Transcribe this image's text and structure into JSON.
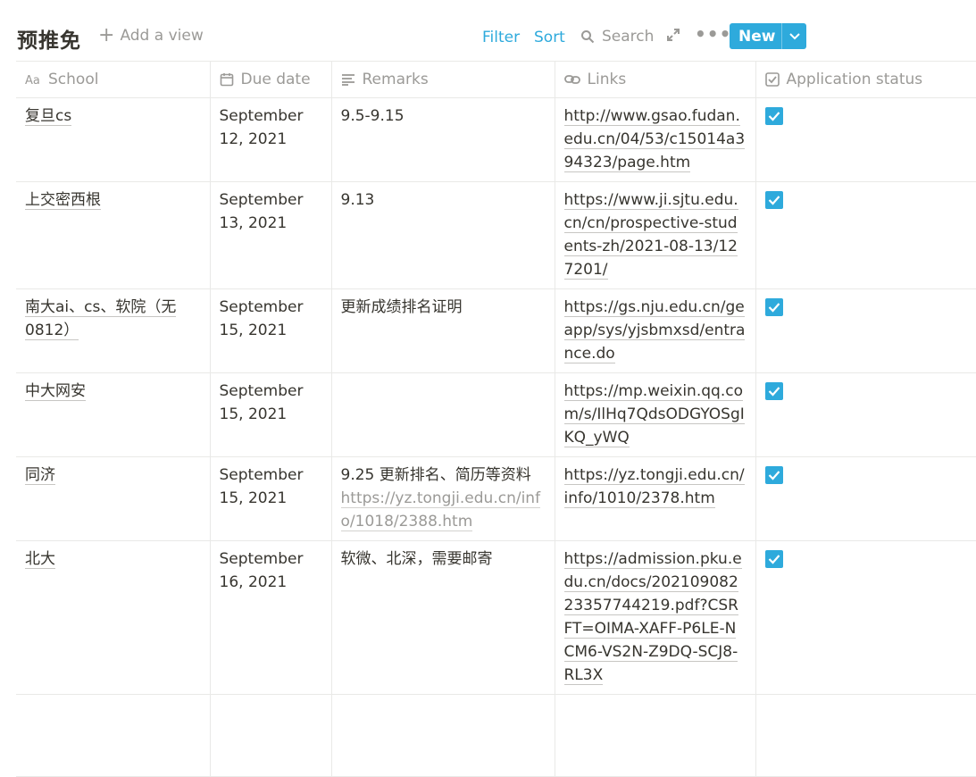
{
  "page": {
    "title": "预推免",
    "add_view": "Add a view"
  },
  "toolbar": {
    "filter": "Filter",
    "sort": "Sort",
    "search": "Search",
    "new": "New"
  },
  "columns": [
    {
      "label": "School",
      "icon": "text-aa-icon"
    },
    {
      "label": "Due date",
      "icon": "calendar-icon"
    },
    {
      "label": "Remarks",
      "icon": "text-lines-icon"
    },
    {
      "label": "Links",
      "icon": "link-icon"
    },
    {
      "label": "Application status",
      "icon": "checkbox-icon"
    }
  ],
  "rows": [
    {
      "school": "复旦cs",
      "due": "September 12, 2021",
      "remark": "9.5-9.15",
      "remark_link": "",
      "link": "http://www.gsao.fudan.edu.cn/04/53/c15014a394323/page.htm",
      "status": true
    },
    {
      "school": "上交密西根",
      "due": "September 13, 2021",
      "remark": "9.13",
      "remark_link": "",
      "link": "https://www.ji.sjtu.edu.cn/cn/prospective-students-zh/2021-08-13/127201/",
      "status": true
    },
    {
      "school": "南大ai、cs、软院（无0812）",
      "due": "September 15, 2021",
      "remark": "更新成绩排名证明",
      "remark_link": "",
      "link": "https://gs.nju.edu.cn/geapp/sys/yjsbmxsd/entrance.do",
      "status": true
    },
    {
      "school": "中大网安",
      "due": "September 15, 2021",
      "remark": "",
      "remark_link": "",
      "link": "https://mp.weixin.qq.com/s/IlHq7QdsODGYOSgIKQ_yWQ",
      "status": true
    },
    {
      "school": "同济",
      "due": "September 15, 2021",
      "remark": "9.25 更新排名、简历等资料",
      "remark_link": "https://yz.tongji.edu.cn/info/1018/2388.htm",
      "link": "https://yz.tongji.edu.cn/info/1010/2378.htm",
      "status": true
    },
    {
      "school": "北大",
      "due": "September 16, 2021",
      "remark": "软微、北深，需要邮寄",
      "remark_link": "",
      "link": "https://admission.pku.edu.cn/docs/20210908223357744219.pdf?CSRFT=OIMA-XAFF-P6LE-NCM6-VS2N-Z9DQ-SCJ8-RL3X",
      "status": true
    }
  ],
  "colors": {
    "accent": "#2eaadc",
    "text": "#37352f",
    "muted": "#9b9a97",
    "border": "#e9e9e7"
  }
}
